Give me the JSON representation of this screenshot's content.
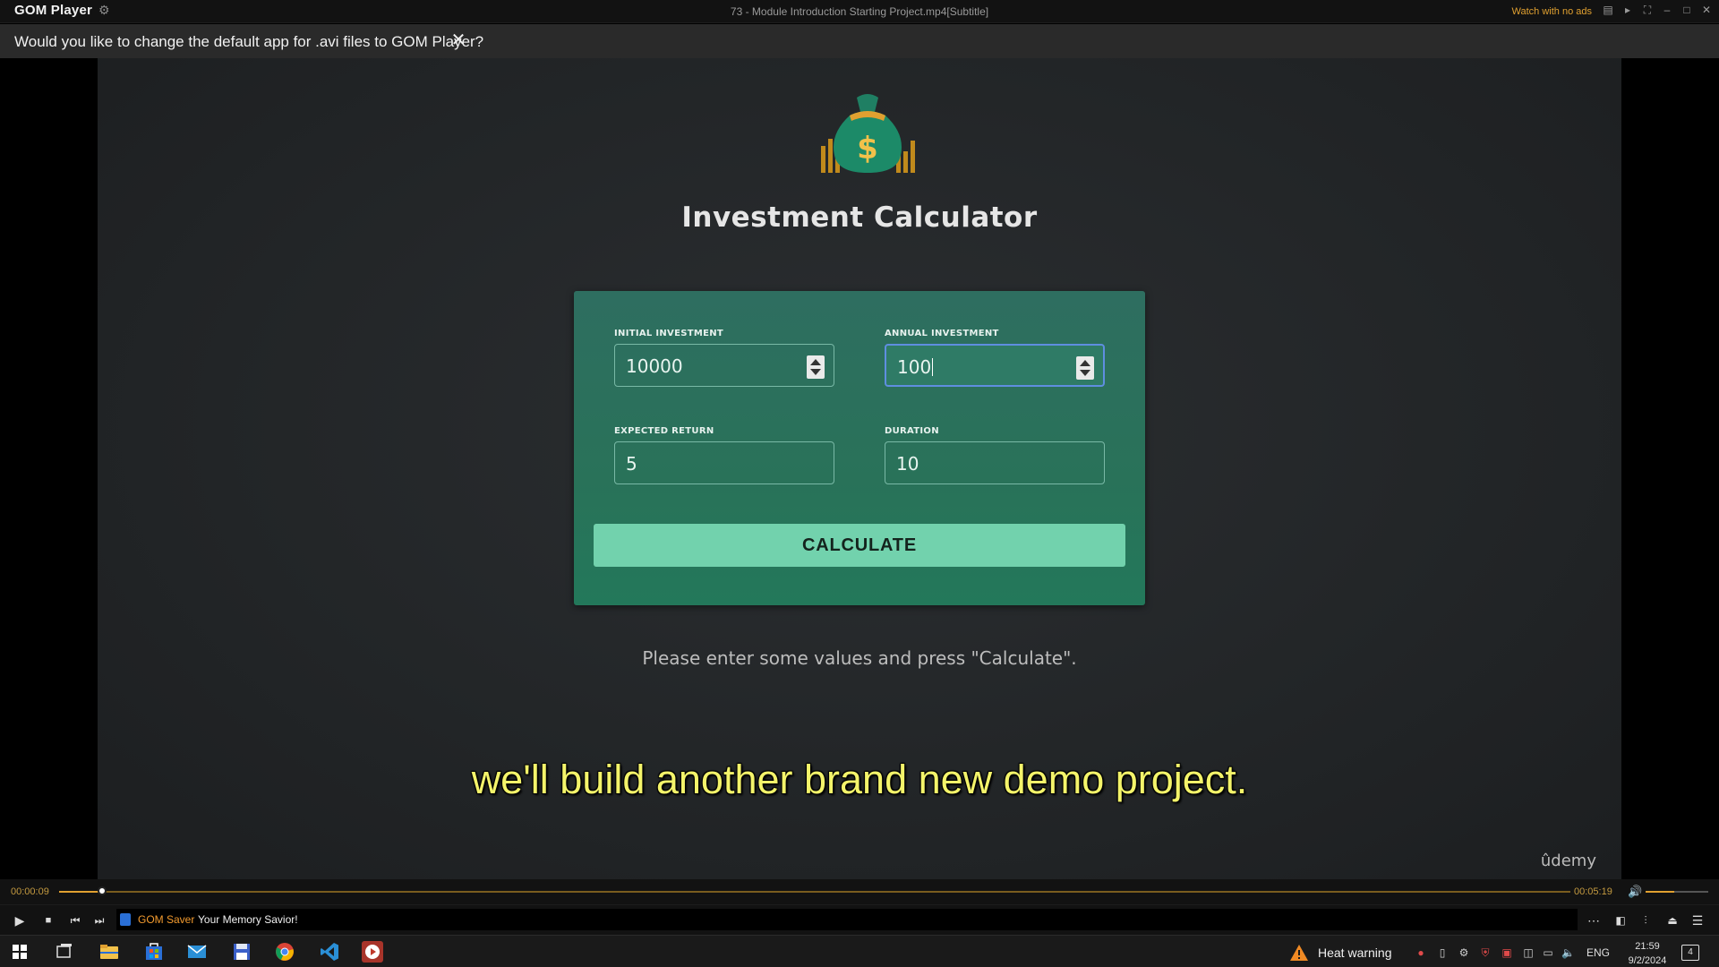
{
  "player": {
    "brand": "GOM Player",
    "window_title": "73 - Module Introduction Starting Project.mp4[Subtitle]",
    "watch_no_ads": "Watch with no ads"
  },
  "notification": {
    "text": "Would you like to change the default app for .avi files to GOM Player?",
    "close_glyph": "✕"
  },
  "video": {
    "app_title": "Investment Calculator",
    "form": {
      "initial_investment": {
        "label": "INITIAL INVESTMENT",
        "value": "10000"
      },
      "annual_investment": {
        "label": "ANNUAL INVESTMENT",
        "value": "100"
      },
      "expected_return": {
        "label": "EXPECTED RETURN",
        "value": "5"
      },
      "duration": {
        "label": "DURATION",
        "value": "10"
      },
      "calculate_label": "CALCULATE"
    },
    "hint": "Please enter some values and press \"Calculate\".",
    "subtitle": "we'll build another brand new demo project.",
    "watermark": "ûdemy"
  },
  "playback": {
    "current_time": "00:00:09",
    "total_time": "00:05:19",
    "progress_fraction": 0.029,
    "volume_fraction": 0.45
  },
  "ad_banner": {
    "brand": "GOM Saver",
    "text": "Your Memory Savior!"
  },
  "taskbar": {
    "heat_warning": "Heat warning",
    "language": "ENG",
    "time": "21:59",
    "date": "9/2/2024",
    "notification_count": "4"
  },
  "colors": {
    "accent": "#e0a030",
    "card": "#297259",
    "button": "#72d2ad",
    "subtitle": "#f4f46a"
  }
}
